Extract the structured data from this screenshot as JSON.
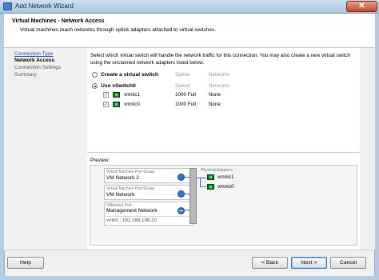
{
  "window": {
    "title": "Add Network Wizard",
    "close_glyph": "✕"
  },
  "header": {
    "title": "Virtual Machines - Network Access",
    "description": "Virtual machines reach networks through uplink adapters attached to virtual switches."
  },
  "nav": {
    "steps": [
      {
        "label": "Connection Type",
        "state": "link"
      },
      {
        "label": "Network Access",
        "state": "current"
      },
      {
        "label": "Connection Settings",
        "state": "upcoming"
      },
      {
        "label": "Summary",
        "state": "upcoming"
      }
    ]
  },
  "main": {
    "instructions": "Select which virtual switch will handle the network traffic for this connection. You may also create a new virtual switch using the unclaimed network adapters listed below.",
    "option_create": {
      "label": "Create a virtual switch",
      "speed_header": "Speed",
      "networks_header": "Networks",
      "selected": false
    },
    "option_use": {
      "label": "Use vSwitch0",
      "speed_header": "Speed",
      "networks_header": "Networks",
      "selected": true,
      "nics": [
        {
          "name": "vmnic1",
          "speed": "1000 Full",
          "networks": "None",
          "checked": true
        },
        {
          "name": "vmnic0",
          "speed": "1000 Full",
          "networks": "None",
          "checked": true
        }
      ]
    }
  },
  "preview": {
    "label": "Preview:",
    "port_groups": [
      {
        "caption": "Virtual Machine Port Group",
        "name": "VM Network 2"
      },
      {
        "caption": "Virtual Machine Port Group",
        "name": "VM Network"
      },
      {
        "caption": "VMkernel Port",
        "name": "Management Network",
        "vmk": "vmk0 : 192.168.108.20"
      }
    ],
    "physical_adapters": {
      "caption": "Physical Adapters",
      "nics": [
        "vmnic1",
        "vmnic0"
      ]
    }
  },
  "buttons": {
    "help": "Help",
    "back": "< Back",
    "next": "Next >",
    "cancel": "Cancel"
  },
  "icons": {
    "app": "network-wizard-icon",
    "nic": "network-adapter-icon",
    "port_group": "port-group-icon",
    "close": "close-icon"
  },
  "colors": {
    "accent": "#3573c6",
    "link": "#2a4fb0",
    "nic_green": "#1f7a2c"
  }
}
